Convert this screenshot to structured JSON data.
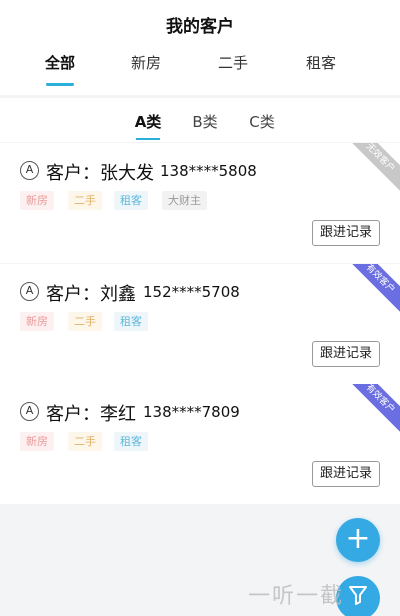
{
  "header": {
    "title": "我的客户",
    "tabs": [
      "全部",
      "新房",
      "二手",
      "租客"
    ]
  },
  "subtabs": [
    "A类",
    "B类",
    "C类"
  ],
  "customers": [
    {
      "grade": "A",
      "label": "客户：",
      "name": "张大发",
      "phone": "138****5808",
      "tags": {
        "new": "新房",
        "used": "二手",
        "rent": "租客",
        "rich": "大财主"
      },
      "status": "无效客户",
      "follow_label": "跟进记录"
    },
    {
      "grade": "A",
      "label": "客户：",
      "name": "刘鑫",
      "phone": "152****5708",
      "tags": {
        "new": "新房",
        "used": "二手",
        "rent": "租客"
      },
      "status": "有效客户",
      "follow_label": "跟进记录"
    },
    {
      "grade": "A",
      "label": "客户：",
      "name": "李红",
      "phone": "138****7809",
      "tags": {
        "new": "新房",
        "used": "二手",
        "rent": "租客"
      },
      "status": "有效客户",
      "follow_label": "跟进记录"
    }
  ],
  "fab": {
    "add_symbol": "+",
    "filter_icon": "filter-icon"
  },
  "watermark": "一听一截",
  "colors": {
    "accent": "#2ab0d8",
    "fab": "#35a9e3",
    "valid": "#6b6ee0",
    "invalid": "#c8c8c8"
  }
}
